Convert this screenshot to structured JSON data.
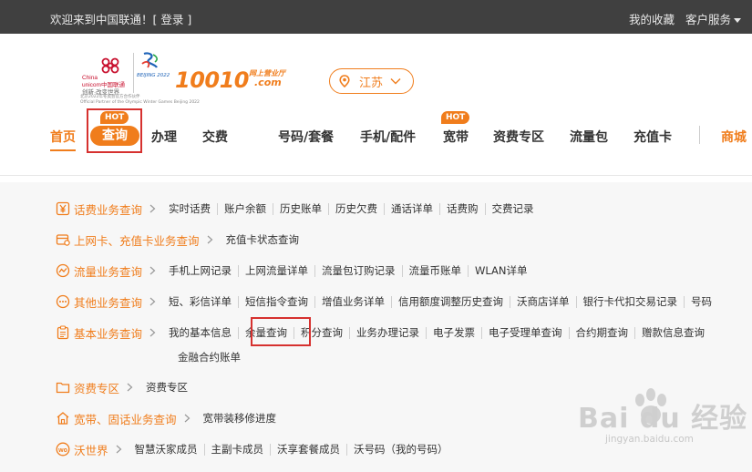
{
  "topbar": {
    "welcome": "欢迎来到中国联通！",
    "login": "[ 登录 ]",
    "favorites": "我的收藏",
    "service": "客户服务"
  },
  "logo": {
    "unicom_cn": "China",
    "unicom_line2": "unicom中国联通",
    "unicom_slogan": "创新·改变世界",
    "olympic_label": "BEIJING 2022",
    "partner": "北京2022年冬奥会官方合作伙伴",
    "partner_en": "Official Partner of the Olympic Winter Games Beijing 2022",
    "brand_number": "10010",
    "brand_sub": "网上营业厅",
    "brand_com": ".com"
  },
  "province": {
    "value": "江苏"
  },
  "nav": {
    "home": "首页",
    "query": "查询",
    "handle": "办理",
    "pay": "交费",
    "number": "号码/套餐",
    "phone": "手机/配件",
    "broadband": "宽带",
    "tariff": "资费专区",
    "traffic": "流量包",
    "recharge": "充值卡",
    "mall": "商城",
    "hot": "HOT"
  },
  "menu": {
    "rows": [
      {
        "label": "话费业务查询",
        "icon": "yen-icon",
        "links": [
          "实时话费",
          "账户余额",
          "历史账单",
          "历史欠费",
          "通话详单",
          "话费购",
          "交费记录"
        ]
      },
      {
        "label": "上网卡、充值卡业务查询",
        "icon": "card-icon",
        "links": [
          "充值卡状态查询"
        ]
      },
      {
        "label": "流量业务查询",
        "icon": "wave-icon",
        "links": [
          "手机上网记录",
          "上网流量详单",
          "流量包订购记录",
          "流量币账单",
          "WLAN详单"
        ]
      },
      {
        "label": "其他业务查询",
        "icon": "dots-icon",
        "links": [
          "短、彩信详单",
          "短信指令查询",
          "增值业务详单",
          "信用额度调整历史查询",
          "沃商店详单",
          "银行卡代扣交易记录",
          "号码"
        ]
      },
      {
        "label": "基本业务查询",
        "icon": "clipboard-icon",
        "links": [
          "我的基本信息",
          "余量查询",
          "积分查询",
          "业务办理记录",
          "电子发票",
          "电子受理单查询",
          "合约期查询",
          "赠款信息查询"
        ]
      },
      {
        "label": "资费专区",
        "icon": "folder-icon",
        "links": [
          "资费专区"
        ]
      },
      {
        "label": "宽带、固话业务查询",
        "icon": "house-icon",
        "links": [
          "宽带装移修进度"
        ]
      },
      {
        "label": "沃世界",
        "icon": "wo-icon",
        "links": [
          "智慧沃家成员",
          "主副卡成员",
          "沃享套餐成员",
          "沃号码（我的号码）"
        ]
      }
    ],
    "wrap_link": "金融合约账单"
  },
  "watermark": {
    "brand": "Bai du 经验",
    "url": "jingyan.baidu.com"
  },
  "colors": {
    "accent": "#f07d1c",
    "highlight": "#d6312f",
    "topbar": "#404040"
  }
}
